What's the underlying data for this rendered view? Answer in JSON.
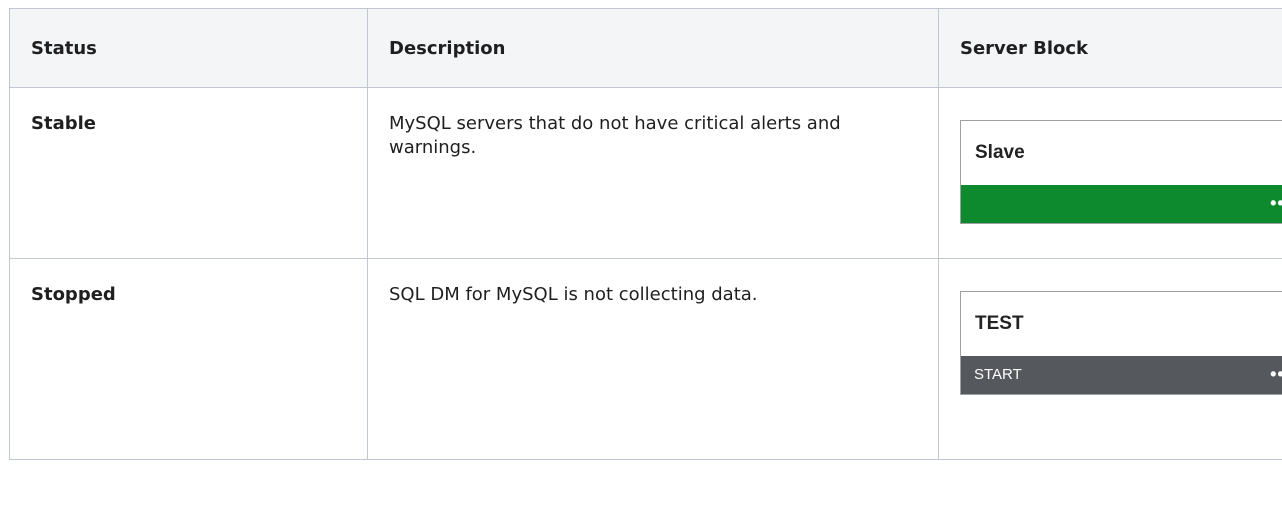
{
  "table": {
    "headers": [
      "Status",
      "Description",
      "Server Block"
    ],
    "rows": [
      {
        "status": "Stable",
        "description": "MySQL servers that do not have critical alerts and warnings.",
        "block": {
          "name": "Slave",
          "bar_label": "",
          "menu_glyph": "•••",
          "bar_color": "#0e8a2e",
          "menu_icon": "ellipsis-icon"
        }
      },
      {
        "status": "Stopped",
        "description": "SQL DM for MySQL is not collecting data.",
        "block": {
          "name": "TEST",
          "bar_label": "START",
          "menu_glyph": "•••",
          "bar_color": "#55585c",
          "menu_icon": "ellipsis-icon"
        }
      }
    ]
  }
}
